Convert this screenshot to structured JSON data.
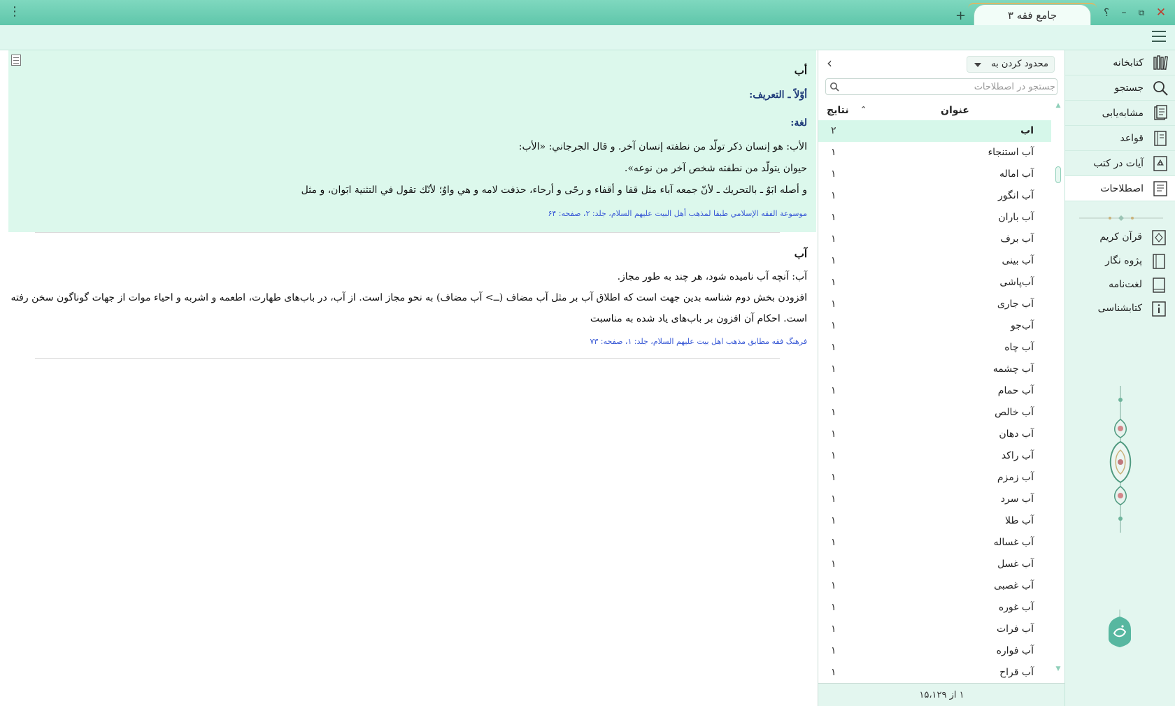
{
  "window": {
    "tab_title": "جامع فقه ۳",
    "menu_glyph": "⋮",
    "add_tab_glyph": "+",
    "help_glyph": "؟",
    "minimize_glyph": "–",
    "maximize_glyph": "⧉",
    "close_glyph": "✕"
  },
  "sidebar": {
    "items": [
      {
        "label": "کتابخانه",
        "icon": "library-icon"
      },
      {
        "label": "جستجو",
        "icon": "search-icon"
      },
      {
        "label": "مشابه‌یابی",
        "icon": "similarity-icon"
      },
      {
        "label": "قواعد",
        "icon": "rules-book-icon"
      },
      {
        "label": "آیات در کتب",
        "icon": "verses-icon"
      },
      {
        "label": "اصطلاحات",
        "icon": "terms-icon"
      }
    ],
    "active_item": "اصطلاحات",
    "secondary_items": [
      {
        "label": "قرآن کریم",
        "icon": "quran-icon"
      },
      {
        "label": "پژوه نگار",
        "icon": "notebook-icon"
      },
      {
        "label": "لغت‌نامه",
        "icon": "dictionary-icon"
      },
      {
        "label": "کتابشناسی",
        "icon": "bibliography-icon"
      }
    ]
  },
  "terms_panel": {
    "limit_dropdown": "محدود کردن به",
    "collapse_glyph": "‹",
    "search_placeholder": "جستجو در اصطلاحات",
    "column_title": "عنوان",
    "column_results": "نتایج",
    "sort_glyph": "⌃",
    "rows": [
      {
        "title": "اب",
        "count": "۲",
        "selected": true
      },
      {
        "title": "آب استنجاء",
        "count": "۱"
      },
      {
        "title": "آب اماله",
        "count": "۱"
      },
      {
        "title": "آب انگور",
        "count": "۱"
      },
      {
        "title": "آب باران",
        "count": "۱"
      },
      {
        "title": "آب برف",
        "count": "۱"
      },
      {
        "title": "آب بینی",
        "count": "۱"
      },
      {
        "title": "آب‌پاشی",
        "count": "۱"
      },
      {
        "title": "آب جاری",
        "count": "۱"
      },
      {
        "title": "آب‌جو",
        "count": "۱"
      },
      {
        "title": "آب چاه",
        "count": "۱"
      },
      {
        "title": "آب چشمه",
        "count": "۱"
      },
      {
        "title": "آب حمام",
        "count": "۱"
      },
      {
        "title": "آب خالص",
        "count": "۱"
      },
      {
        "title": "آب دهان",
        "count": "۱"
      },
      {
        "title": "آب راکد",
        "count": "۱"
      },
      {
        "title": "آب زمزم",
        "count": "۱"
      },
      {
        "title": "آب سرد",
        "count": "۱"
      },
      {
        "title": "آب طلا",
        "count": "۱"
      },
      {
        "title": "آب غساله",
        "count": "۱"
      },
      {
        "title": "آب غسل",
        "count": "۱"
      },
      {
        "title": "آب غصبی",
        "count": "۱"
      },
      {
        "title": "آب غوره",
        "count": "۱"
      },
      {
        "title": "آب فرات",
        "count": "۱"
      },
      {
        "title": "آب فواره",
        "count": "۱"
      },
      {
        "title": "آب قراح",
        "count": "۱"
      }
    ],
    "footer": "۱ از ۱۵،۱۲۹"
  },
  "entries": [
    {
      "heading": "أب",
      "subheading": "أوّلاً ـ التعريف:",
      "subheading2": "لغة:",
      "lines": [
        "الأب: هو إنسان ذكر تولّد من نطفته إنسان آخر. و قال الجرجاني: «الأب:",
        "حيوان يتولّد من نطفته شخص آخر من نوعه».",
        "و أصله ابَوٌ ـ بالتحريك ـ لأنّ جمعه آباء مثل قفا و أقفاء و رحًى و أرحاء، حذفت لامه و هي واوٌ؛ لأنّك تقول في التثنية ابَوان، و مثل"
      ],
      "source": "موسوعة الفقه الإسلامي طبقا لمذهب أهل البيت عليهم السلام، جلد: ۲، صفحه: ۶۴"
    },
    {
      "heading": "آب",
      "lines": [
        "آب: آنچه آب نامیده شود، هر چند به طور مجاز.",
        "افزودن بخش دوم شناسه بدین جهت است که اطلاق آب بر مثل آب مضاف (ــ> آب مضاف) به نحو مجاز است. از آب، در باب‌های طهارت، اطعمه و اشربه و احیاء موات از جهات گوناگون سخن رفته",
        "است. احکام آن افزون بر باب‌های یاد شده به مناسبت"
      ],
      "source": "فرهنگ فقه مطابق مذهب اهل بیت علیهم السلام، جلد: ۱، صفحه: ۷۳"
    }
  ],
  "colors": {
    "titlebar": "#5fc6aa",
    "selected_bg": "#dcf8ec",
    "source_link": "#3b5bd6"
  }
}
